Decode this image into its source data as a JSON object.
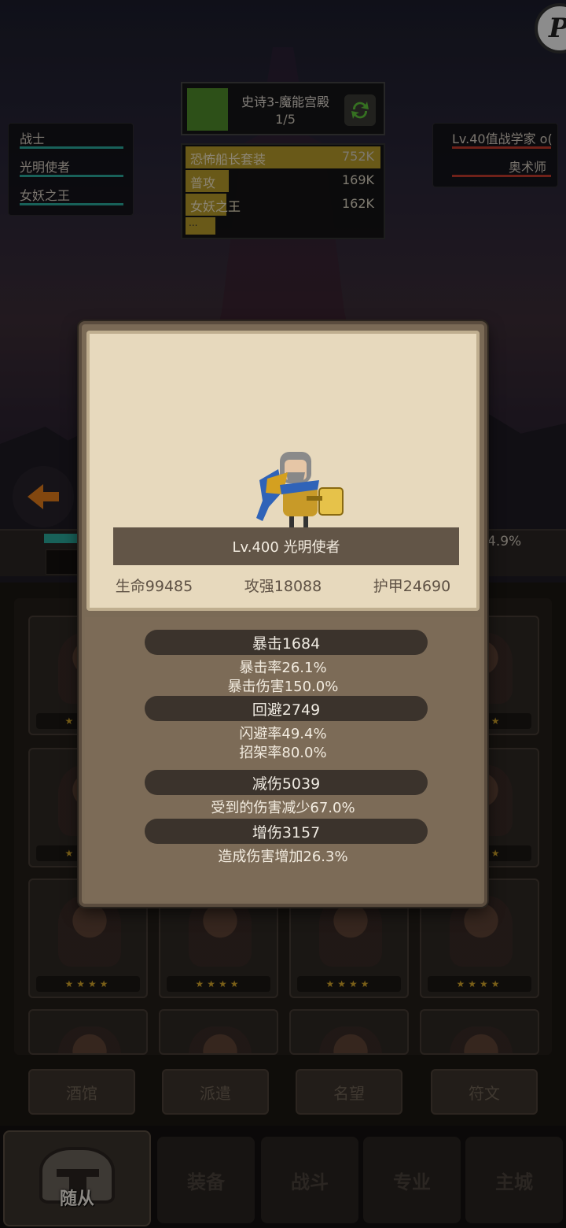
{
  "team": [
    {
      "name": "战士"
    },
    {
      "name": "光明使者"
    },
    {
      "name": "女妖之王"
    }
  ],
  "stage": {
    "title": "史诗3-魔能宫殿",
    "progress": "1/5"
  },
  "damage_ranking": [
    {
      "name": "恐怖船长套装",
      "value": "752K",
      "fill": 1.0
    },
    {
      "name": "普攻",
      "value": "169K",
      "fill": 0.22
    },
    {
      "name": "女妖之王",
      "value": "162K",
      "fill": 0.21
    }
  ],
  "damage_more": "...",
  "enemy": {
    "title": "Lv.40值战学家 o(",
    "class": "奥术师"
  },
  "battle_percent": "4.9%",
  "modal": {
    "hero_name": "Lv.400 光明使者",
    "base_stats": [
      "生命99485",
      "攻强18088",
      "护甲24690"
    ],
    "crit": {
      "label": "暴击1684",
      "lines": [
        "暴击率26.1%",
        "暴击伤害150.0%"
      ]
    },
    "dodge": {
      "label": "回避2749",
      "lines": [
        "闪避率49.4%",
        "招架率80.0%"
      ]
    },
    "reduce": {
      "label": "减伤5039",
      "lines": [
        "受到的伤害减少67.0%"
      ]
    },
    "boost": {
      "label": "增伤3157",
      "lines": [
        "造成伤害增加26.3%"
      ]
    }
  },
  "sub_buttons": [
    "酒馆",
    "派遣",
    "名望",
    "符文"
  ],
  "nav": {
    "active": "随从",
    "tabs": [
      "装备",
      "战斗",
      "专业",
      "主城"
    ]
  },
  "hero_grid_stars": "★★★★",
  "colors": {
    "team_hp": "#2aa89a",
    "enemy_hp": "#c0392b",
    "damage_bar": "#b69a2a",
    "modal_parchment": "#e7d9bd",
    "modal_frame": "#7a6a56"
  }
}
